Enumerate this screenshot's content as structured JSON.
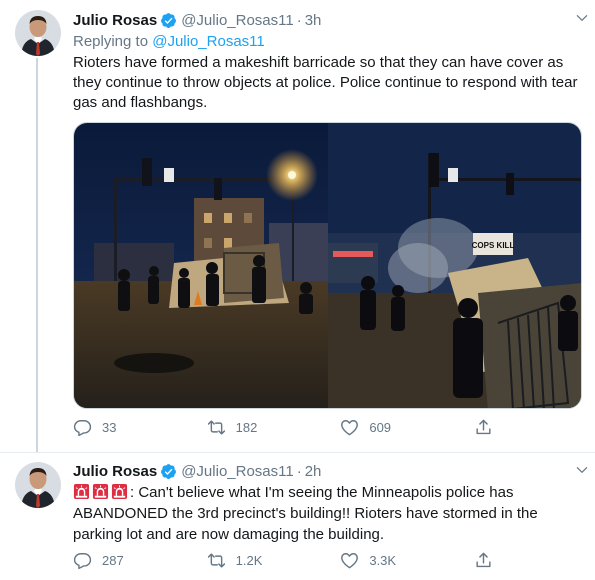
{
  "colors": {
    "accent": "#1da1f2",
    "text": "#14171a",
    "secondary": "#657786",
    "divider": "#e6ecf0"
  },
  "tweets": [
    {
      "name": "Julio Rosas",
      "handle": "@Julio_Rosas11",
      "dot": "·",
      "time": "3h",
      "reply_prefix": "Replying to",
      "reply_handle": "@Julio_Rosas11",
      "text": "Rioters have formed a makeshift barricade so that they can have cover as they continue to throw objects at police. Police continue to respond with tear gas and flashbangs.",
      "icons": {
        "verified": "verified-badge-icon",
        "caret": "chevron-down-icon"
      },
      "media": [
        {
          "icon": "photo-night-barricade"
        },
        {
          "icon": "photo-night-barricade-closeup",
          "sign": "COPS KILL"
        }
      ],
      "stats": {
        "replies": "33",
        "retweets": "182",
        "likes": "609"
      }
    },
    {
      "name": "Julio Rosas",
      "handle": "@Julio_Rosas11",
      "dot": "·",
      "time": "2h",
      "emojis": [
        "police-light-emoji",
        "police-light-emoji",
        "police-light-emoji"
      ],
      "text": ": Can't believe what I'm seeing the Minneapolis police has ABANDONED the 3rd precinct's building!! Rioters have stormed in the parking lot and are now damaging the building.",
      "icons": {
        "verified": "verified-badge-icon",
        "caret": "chevron-down-icon"
      },
      "stats": {
        "replies": "287",
        "retweets": "1.2K",
        "likes": "3.3K"
      }
    }
  ]
}
